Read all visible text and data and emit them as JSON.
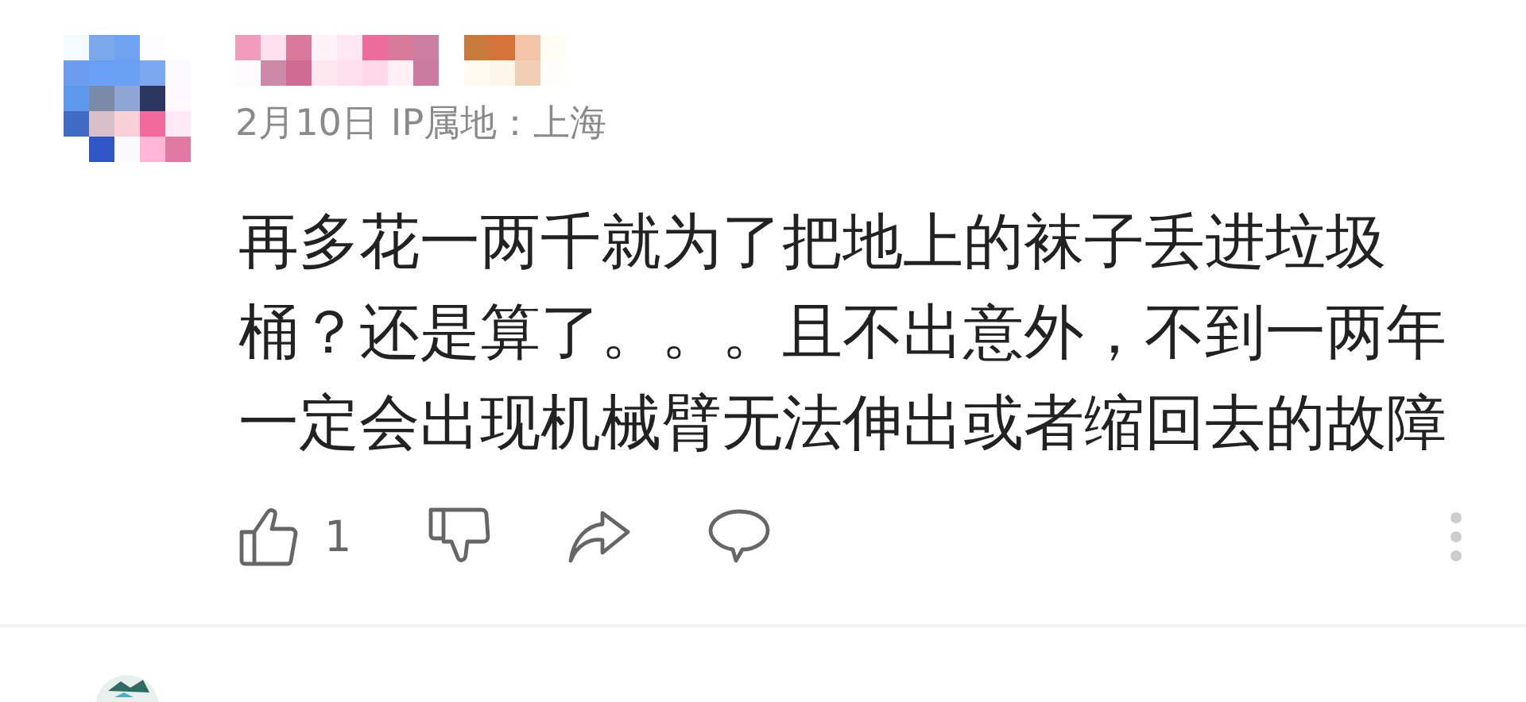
{
  "comment": {
    "date": "2月10日",
    "ip_location": "IP属地：上海",
    "text": "再多花一两千就为了把地上的袜子丢进垃圾桶？还是算了。。。且不出意外，不到一两年一定会出现机械臂无法伸出或者缩回去的故障",
    "likes": "1"
  }
}
